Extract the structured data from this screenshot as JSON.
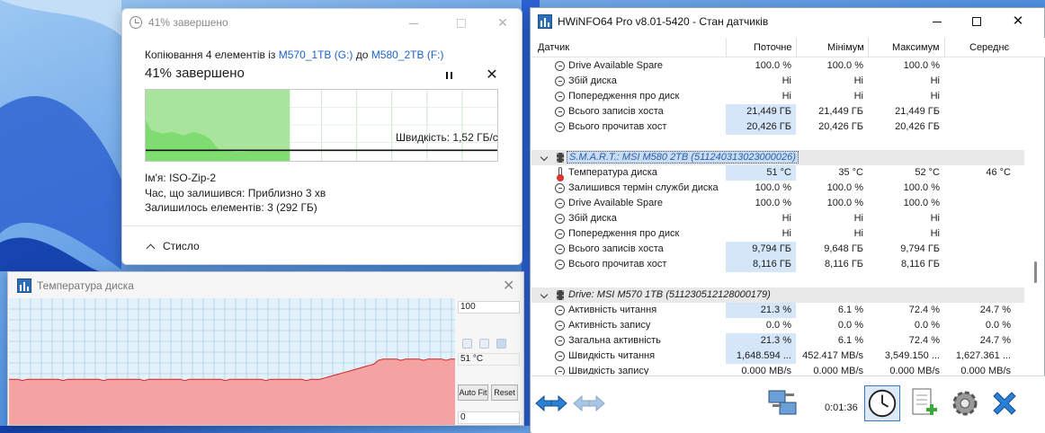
{
  "copy_dialog": {
    "title": "41% завершено",
    "copy_prefix": "Копіювання 4 елементів із",
    "source": "M570_1TB (G:)",
    "copy_to": "до",
    "destination": "M580_2TB (F:)",
    "percent_text": "41% завершено",
    "progress_percent": 41,
    "speed": "Швидкість: 1,52 ГБ/с",
    "name_label": "Ім'я:",
    "name_value": "ISO-Zip-2",
    "time_left_label": "Час, що залишився:",
    "time_left_value": "Приблизно 3 хв",
    "items_left_label": "Залишилось елементів:",
    "items_left_value": "3 (292 ГБ)",
    "fewer_details": "Стисло"
  },
  "temp_window": {
    "title": "Температура диска",
    "max_value": "100",
    "current_value": "51 °C",
    "min_value": "0",
    "auto_fit_label": "Auto Fit",
    "reset_label": "Reset"
  },
  "hwinfo": {
    "title": "HWiNFO64 Pro v8.01-5420 - Стан датчиків",
    "columns": [
      "Датчик",
      "Поточне",
      "Мінімум",
      "Максимум",
      "Середнє"
    ],
    "elapsed": "0:01:36",
    "rows": [
      {
        "type": "sensor",
        "label": "Drive Available Spare",
        "current": "100.0 %",
        "min": "100.0 %",
        "max": "100.0 %",
        "avg": "",
        "hl": false
      },
      {
        "type": "sensor",
        "label": "Збій диска",
        "current": "Ні",
        "min": "Ні",
        "max": "Ні",
        "avg": "",
        "hl": false
      },
      {
        "type": "sensor",
        "label": "Попередження про диск",
        "current": "Ні",
        "min": "Ні",
        "max": "Ні",
        "avg": "",
        "hl": false
      },
      {
        "type": "sensor",
        "label": "Всього записів хоста",
        "current": "21,449 ГБ",
        "min": "21,449 ГБ",
        "max": "21,449 ГБ",
        "avg": "",
        "hl": true
      },
      {
        "type": "sensor",
        "label": "Всього прочитав хост",
        "current": "20,426 ГБ",
        "min": "20,426 ГБ",
        "max": "20,426 ГБ",
        "avg": "",
        "hl": true
      },
      {
        "type": "blank"
      },
      {
        "type": "group",
        "label": "S.M.A.R.T.: MSI M580 2TB (511240313023000026)",
        "selected": true
      },
      {
        "type": "therm",
        "label": "Температура диска",
        "current": "51 °C",
        "min": "35 °C",
        "max": "52 °C",
        "avg": "46 °C",
        "hl": true
      },
      {
        "type": "sensor",
        "label": "Залишився термін служби диска",
        "current": "100.0 %",
        "min": "100.0 %",
        "max": "100.0 %",
        "avg": "",
        "hl": false
      },
      {
        "type": "sensor",
        "label": "Drive Available Spare",
        "current": "100.0 %",
        "min": "100.0 %",
        "max": "100.0 %",
        "avg": "",
        "hl": false
      },
      {
        "type": "sensor",
        "label": "Збій диска",
        "current": "Ні",
        "min": "Ні",
        "max": "Ні",
        "avg": "",
        "hl": false
      },
      {
        "type": "sensor",
        "label": "Попередження про диск",
        "current": "Ні",
        "min": "Ні",
        "max": "Ні",
        "avg": "",
        "hl": false
      },
      {
        "type": "sensor",
        "label": "Всього записів хоста",
        "current": "9,794 ГБ",
        "min": "9,648 ГБ",
        "max": "9,794 ГБ",
        "avg": "",
        "hl": true
      },
      {
        "type": "sensor",
        "label": "Всього прочитав хост",
        "current": "8,116 ГБ",
        "min": "8,116 ГБ",
        "max": "8,116 ГБ",
        "avg": "",
        "hl": true
      },
      {
        "type": "blank"
      },
      {
        "type": "group",
        "label": "Drive: MSI M570 1TB (511230512128000179)",
        "selected": false
      },
      {
        "type": "sensor",
        "label": "Активність читання",
        "current": "21.3 %",
        "min": "6.1 %",
        "max": "72.4 %",
        "avg": "24.7 %",
        "hl": true
      },
      {
        "type": "sensor",
        "label": "Активність запису",
        "current": "0.0 %",
        "min": "0.0 %",
        "max": "0.0 %",
        "avg": "0.0 %",
        "hl": false
      },
      {
        "type": "sensor",
        "label": "Загальна активність",
        "current": "21.3 %",
        "min": "6.1 %",
        "max": "72.4 %",
        "avg": "24.7 %",
        "hl": true
      },
      {
        "type": "sensor",
        "label": "Швидкість читання",
        "current": "1,648.594 ...",
        "min": "452.417 MB/s",
        "max": "3,549.150 ...",
        "avg": "1,627.361 ...",
        "hl": true
      },
      {
        "type": "sensor",
        "label": "Швидкість запису",
        "current": "0.000 MB/s",
        "min": "0.000 MB/s",
        "max": "0.000 MB/s",
        "avg": "0.000 MB/s",
        "hl": false
      }
    ]
  },
  "colors": {
    "progress_fill": "#7fdc70",
    "temp_fill": "#f4a3a3",
    "temp_line": "#d32020",
    "highlight": "#d6e6f9"
  }
}
